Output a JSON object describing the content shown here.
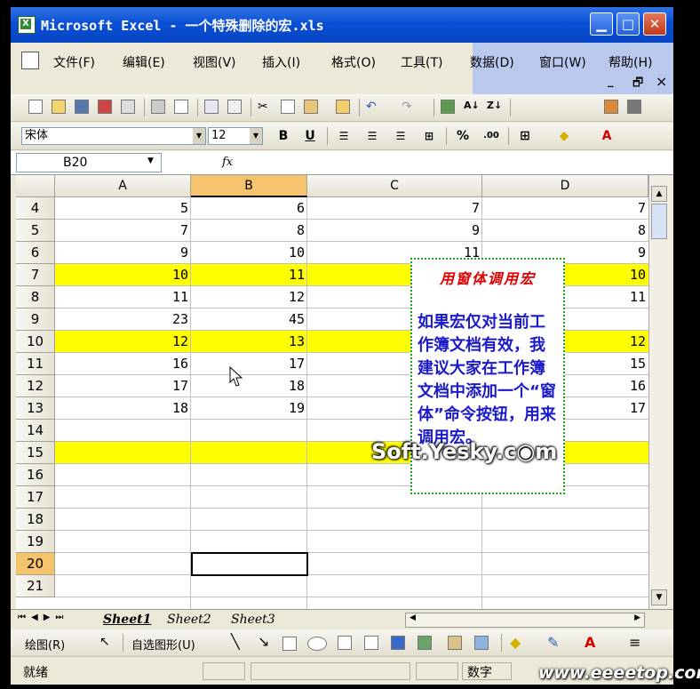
{
  "window": {
    "title": "Microsoft Excel - 一个特殊删除的宏.xls"
  },
  "menu": [
    "文件(F)",
    "编辑(E)",
    "视图(V)",
    "插入(I)",
    "格式(O)",
    "工具(T)",
    "数据(D)",
    "窗口(W)",
    "帮助(H)"
  ],
  "menu_right": {
    "minimize": "_",
    "restore": "🗗",
    "close": "×"
  },
  "font": {
    "name": "宋体",
    "size": "12"
  },
  "format_buttons": {
    "bold": "B",
    "underline": "U",
    "percent": "%"
  },
  "formula_bar": {
    "name_box": "B20",
    "fx_label": "fx"
  },
  "columns": [
    "A",
    "B",
    "C",
    "D"
  ],
  "rows": [
    {
      "num": "4",
      "a": "5",
      "b": "6",
      "c": "7",
      "d": "7",
      "yellow": false
    },
    {
      "num": "5",
      "a": "7",
      "b": "8",
      "c": "9",
      "d": "8",
      "yellow": false
    },
    {
      "num": "6",
      "a": "9",
      "b": "10",
      "c": "11",
      "d": "9",
      "yellow": false
    },
    {
      "num": "7",
      "a": "10",
      "b": "11",
      "c": "",
      "d": "10",
      "yellow": true
    },
    {
      "num": "8",
      "a": "11",
      "b": "12",
      "c": "",
      "d": "11",
      "yellow": false
    },
    {
      "num": "9",
      "a": "23",
      "b": "45",
      "c": "",
      "d": "",
      "yellow": false
    },
    {
      "num": "10",
      "a": "12",
      "b": "13",
      "c": "",
      "d": "12",
      "yellow": true
    },
    {
      "num": "11",
      "a": "16",
      "b": "17",
      "c": "",
      "d": "15",
      "yellow": false
    },
    {
      "num": "12",
      "a": "17",
      "b": "18",
      "c": "",
      "d": "16",
      "yellow": false
    },
    {
      "num": "13",
      "a": "18",
      "b": "19",
      "c": "",
      "d": "17",
      "yellow": false
    },
    {
      "num": "14",
      "a": "",
      "b": "",
      "c": "",
      "d": "",
      "yellow": false
    },
    {
      "num": "15",
      "a": "",
      "b": "",
      "c": "",
      "d": "",
      "yellow": true
    },
    {
      "num": "16",
      "a": "",
      "b": "",
      "c": "",
      "d": "",
      "yellow": false
    },
    {
      "num": "17",
      "a": "",
      "b": "",
      "c": "",
      "d": "",
      "yellow": false
    },
    {
      "num": "18",
      "a": "",
      "b": "",
      "c": "",
      "d": "",
      "yellow": false
    },
    {
      "num": "19",
      "a": "",
      "b": "",
      "c": "",
      "d": "",
      "yellow": false
    },
    {
      "num": "20",
      "a": "",
      "b": "",
      "c": "",
      "d": "",
      "yellow": false
    },
    {
      "num": "21",
      "a": "",
      "b": "",
      "c": "",
      "d": "",
      "yellow": false
    }
  ],
  "textbox": {
    "title": "用窗体调用宏",
    "body": "如果宏仅对当前工作簿文档有效，我建议大家在工作簿文档中添加一个“窗体”命令按钮，用来调用宏。"
  },
  "sheet_tabs": [
    "Sheet1",
    "Sheet2",
    "Sheet3"
  ],
  "drawing_toolbar": {
    "draw": "绘图(R)",
    "autoshapes": "自选图形(U)"
  },
  "status": {
    "ready": "就绪",
    "num": "数字"
  },
  "watermarks": {
    "center": "Soft.Yesky.c◉m",
    "corner": "www.eeeetop.com"
  },
  "colors": {
    "highlight": "#ffff00",
    "title_bar": "#0a4fd4",
    "textbox_title": "#e00000",
    "textbox_body": "#1a1acc"
  }
}
